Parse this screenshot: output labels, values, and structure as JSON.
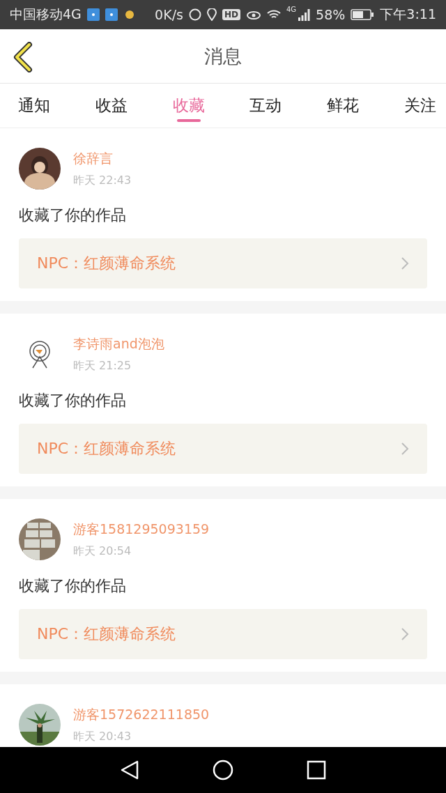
{
  "status_bar": {
    "carrier": "中国移动4G",
    "speed": "0K/s",
    "hd": "HD",
    "network": "4G",
    "battery": "58%",
    "time": "下午3:11"
  },
  "header": {
    "title": "消息"
  },
  "tabs": [
    {
      "label": "通知",
      "selected": false
    },
    {
      "label": "收益",
      "selected": false
    },
    {
      "label": "收藏",
      "selected": true
    },
    {
      "label": "互动",
      "selected": false
    },
    {
      "label": "鲜花",
      "selected": false
    },
    {
      "label": "关注",
      "selected": false
    }
  ],
  "messages": [
    {
      "user": "徐辞言",
      "time": "昨天 22:43",
      "text": "收藏了你的作品",
      "work": "NPC：红颜薄命系统"
    },
    {
      "user": "李诗雨and泡泡",
      "time": "昨天 21:25",
      "text": "收藏了你的作品",
      "work": "NPC：红颜薄命系统"
    },
    {
      "user": "游客1581295093159",
      "time": "昨天 20:54",
      "text": "收藏了你的作品",
      "work": "NPC：红颜薄命系统"
    },
    {
      "user": "游客1572622111850",
      "time": "昨天 20:43"
    }
  ]
}
